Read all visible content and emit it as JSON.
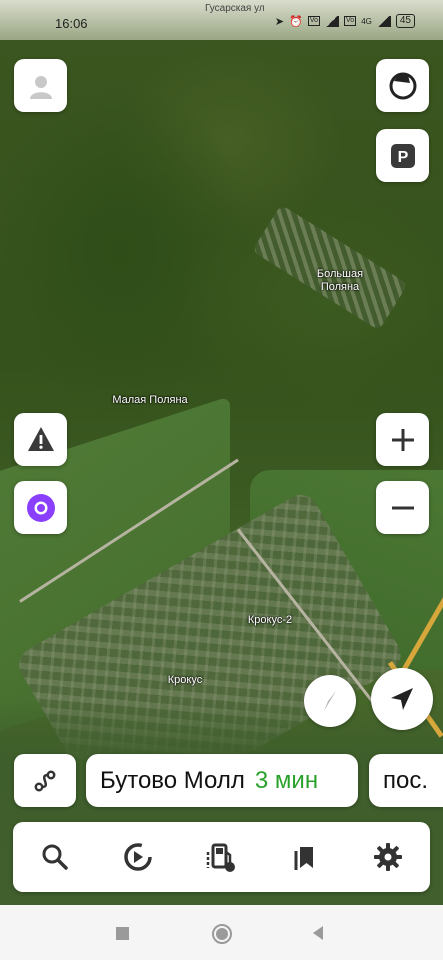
{
  "status_bar": {
    "time": "16:06",
    "street": "Гусарская ул",
    "network_1": "4G",
    "battery": "45"
  },
  "map": {
    "labels": {
      "bolshaya_polyana": "Большая\nПоляна",
      "malaya_polyana": "Малая Поляна",
      "krokus_2": "Крокус-2",
      "krokus": "Крокус"
    }
  },
  "route_suggestions": [
    {
      "destination": "Бутово Молл",
      "eta": "3 мин",
      "eta_color": "#2aa12a"
    },
    {
      "destination": "пос. ",
      "eta": ""
    }
  ],
  "tabs": [
    {
      "icon": "search-icon"
    },
    {
      "icon": "music-icon"
    },
    {
      "icon": "fuel-station-icon"
    },
    {
      "icon": "bookmarks-icon"
    },
    {
      "icon": "settings-icon"
    }
  ],
  "colors": {
    "alice_purple": "#8a3ffc",
    "eta_green": "#2aa12a",
    "compass_red": "#e0442e",
    "road_yellow": "#d7a73b"
  }
}
